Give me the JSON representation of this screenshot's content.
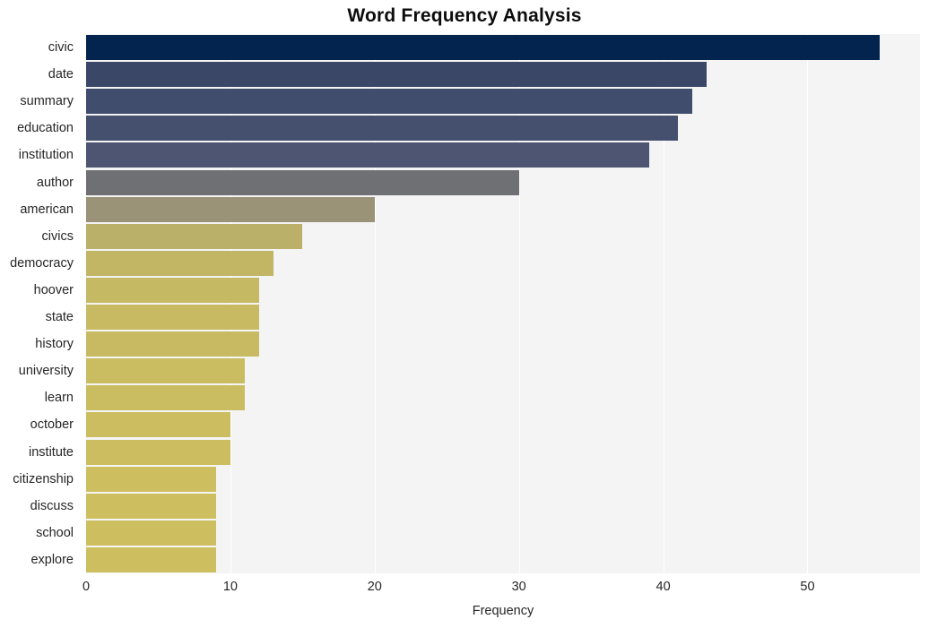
{
  "chart_data": {
    "type": "bar",
    "orientation": "horizontal",
    "title": "Word Frequency Analysis",
    "xlabel": "Frequency",
    "ylabel": "",
    "categories": [
      "civic",
      "date",
      "summary",
      "education",
      "institution",
      "author",
      "american",
      "civics",
      "democracy",
      "hoover",
      "state",
      "history",
      "university",
      "learn",
      "october",
      "institute",
      "citizenship",
      "discuss",
      "school",
      "explore"
    ],
    "values": [
      55,
      43,
      42,
      41,
      39,
      30,
      20,
      15,
      13,
      12,
      12,
      12,
      11,
      11,
      10,
      10,
      9,
      9,
      9,
      9
    ],
    "bar_colors": [
      "#042450",
      "#3b4767",
      "#404d6c",
      "#454f6e",
      "#4d5573",
      "#6e7073",
      "#9a9378",
      "#bab069",
      "#c2b665",
      "#c5b963",
      "#c7ba62",
      "#c7ba62",
      "#c9bc61",
      "#c9bc61",
      "#cbbd60",
      "#cbbd60",
      "#cdbf5f",
      "#cdbf5f",
      "#cdbf5f",
      "#cdbf5f"
    ],
    "xlim": [
      0,
      57.8
    ],
    "xticks": [
      0,
      10,
      20,
      30,
      40,
      50
    ],
    "xtick_labels": [
      "0",
      "10",
      "20",
      "30",
      "40",
      "50"
    ],
    "grid": true,
    "grid_axis": "x",
    "grid_color": "#ffffff",
    "plot_background": "#f4f4f5",
    "figure_background": "#ffffff",
    "legend": null
  }
}
